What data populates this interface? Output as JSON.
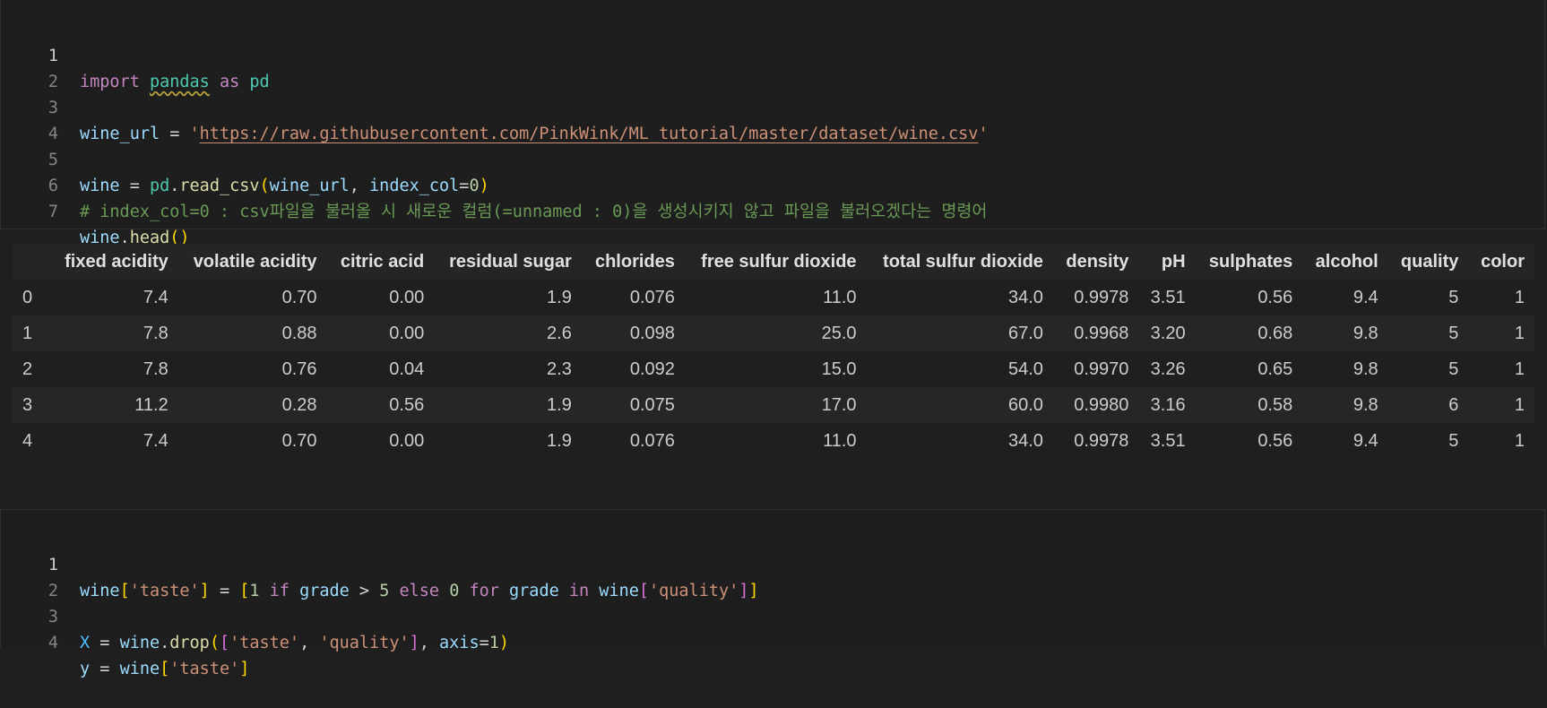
{
  "cell1": {
    "line_numbers": [
      "1",
      "2",
      "3",
      "4",
      "5",
      "6",
      "7"
    ],
    "t1_import": "import",
    "t1_pandas": "pandas",
    "t1_as": "as",
    "t1_pd": "pd",
    "t3_var": "wine_url",
    "t3_eq": " = ",
    "t3_q1": "'",
    "t3_url": "https://raw.githubusercontent.com/PinkWink/ML_tutorial/master/dataset/wine.csv",
    "t3_q2": "'",
    "t5_wine": "wine",
    "t5_eq": " = ",
    "t5_pd": "pd",
    "t5_dot": ".",
    "t5_fn": "read_csv",
    "t5_open": "(",
    "t5_arg": "wine_url",
    "t5_comma": ", ",
    "t5_kw": "index_col",
    "t5_assign": "=",
    "t5_num": "0",
    "t5_close": ")",
    "t6_comment": "# index_col=0 : csv파일을 불러올 시 새로운 컬럼(=unnamed : 0)을 생성시키지 않고 파일을 불러오겠다는 명령어",
    "t7_wine": "wine",
    "t7_dot": ".",
    "t7_fn": "head",
    "t7_parens": "()"
  },
  "table": {
    "columns": [
      "",
      "fixed acidity",
      "volatile acidity",
      "citric acid",
      "residual sugar",
      "chlorides",
      "free sulfur dioxide",
      "total sulfur dioxide",
      "density",
      "pH",
      "sulphates",
      "alcohol",
      "quality",
      "color"
    ],
    "rows": [
      [
        "0",
        "7.4",
        "0.70",
        "0.00",
        "1.9",
        "0.076",
        "11.0",
        "34.0",
        "0.9978",
        "3.51",
        "0.56",
        "9.4",
        "5",
        "1"
      ],
      [
        "1",
        "7.8",
        "0.88",
        "0.00",
        "2.6",
        "0.098",
        "25.0",
        "67.0",
        "0.9968",
        "3.20",
        "0.68",
        "9.8",
        "5",
        "1"
      ],
      [
        "2",
        "7.8",
        "0.76",
        "0.04",
        "2.3",
        "0.092",
        "15.0",
        "54.0",
        "0.9970",
        "3.26",
        "0.65",
        "9.8",
        "5",
        "1"
      ],
      [
        "3",
        "11.2",
        "0.28",
        "0.56",
        "1.9",
        "0.075",
        "17.0",
        "60.0",
        "0.9980",
        "3.16",
        "0.58",
        "9.8",
        "6",
        "1"
      ],
      [
        "4",
        "7.4",
        "0.70",
        "0.00",
        "1.9",
        "0.076",
        "11.0",
        "34.0",
        "0.9978",
        "3.51",
        "0.56",
        "9.4",
        "5",
        "1"
      ]
    ]
  },
  "cell2": {
    "line_numbers": [
      "1",
      "2",
      "3",
      "4"
    ],
    "l1": {
      "wine": "wine",
      "ob": "[",
      "taste": "'taste'",
      "cb": "]",
      "eq": " = ",
      "lb": "[",
      "one": "1",
      "sp1": " ",
      "if": "if",
      "sp2": " ",
      "grade": "grade",
      "gt": " > ",
      "five": "5",
      "sp3": " ",
      "else": "else",
      "sp4": " ",
      "zero": "0",
      "sp5": " ",
      "for": "for",
      "sp6": " ",
      "grade2": "grade",
      "sp7": " ",
      "in": "in",
      "sp8": " ",
      "wine2": "wine",
      "ob2": "[",
      "quality": "'quality'",
      "cb2": "]",
      "rb": "]"
    },
    "l3": {
      "X": "X",
      "eq": " = ",
      "wine": "wine",
      "dot": ".",
      "drop": "drop",
      "op": "(",
      "lb": "[",
      "taste": "'taste'",
      "comma": ", ",
      "quality": "'quality'",
      "rb": "]",
      "comma2": ", ",
      "axis": "axis",
      "assign": "=",
      "one": "1",
      "cp": ")"
    },
    "l4": {
      "y": "y",
      "eq": " = ",
      "wine": "wine",
      "ob": "[",
      "taste": "'taste'",
      "cb": "]"
    }
  }
}
